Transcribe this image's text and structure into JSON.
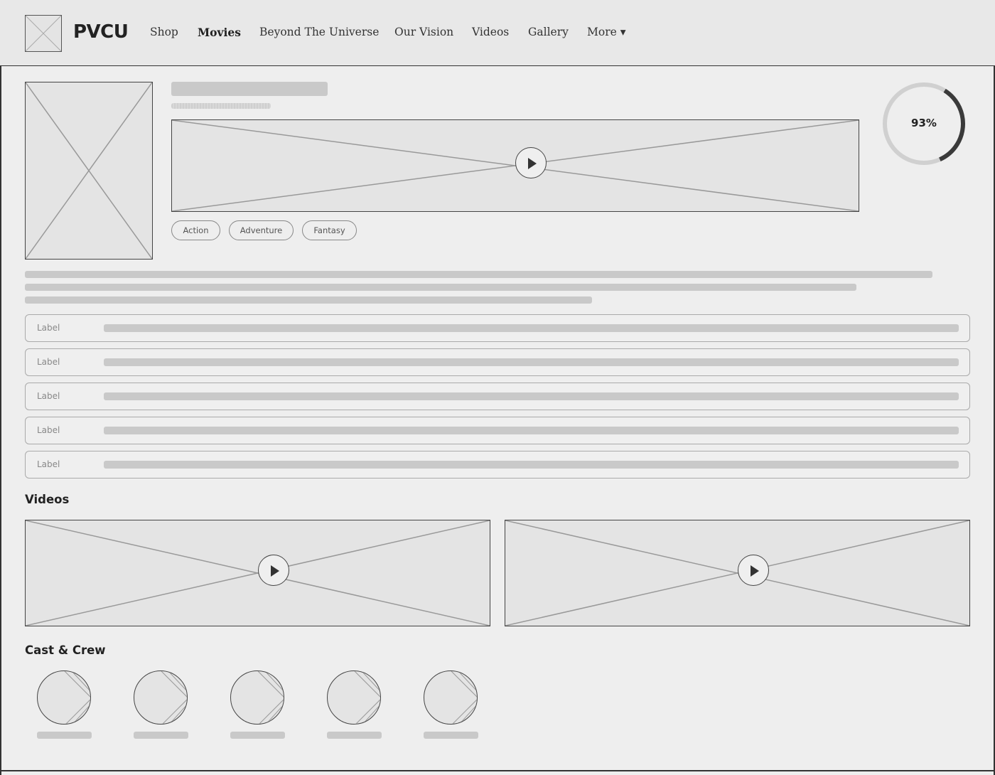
{
  "header": {
    "brand": "PVCU",
    "nav": [
      {
        "label": "Shop",
        "active": false
      },
      {
        "label": "Movies",
        "active": true
      },
      {
        "label": "Beyond The Universe",
        "active": false
      },
      {
        "label": "Our Vision",
        "active": false
      },
      {
        "label": "Videos",
        "active": false
      },
      {
        "label": "Gallery",
        "active": false
      },
      {
        "label": "More ▾",
        "active": false
      }
    ]
  },
  "movie": {
    "genres": [
      "Action",
      "Adventure",
      "Fantasy"
    ],
    "score_label": "93%",
    "score_fraction": 0.93
  },
  "details": {
    "rows": [
      {
        "label": "Label"
      },
      {
        "label": "Label"
      },
      {
        "label": "Label"
      },
      {
        "label": "Label"
      },
      {
        "label": "Label"
      }
    ]
  },
  "videos": {
    "title": "Videos"
  },
  "cast": {
    "title": "Cast & Crew"
  },
  "colors": {
    "background": "#eeeeee",
    "placeholder": "#e4e4e4",
    "skeleton": "#c9c9c9",
    "ring_track": "#d0d0d0",
    "ring_fill": "#3a3a3a"
  }
}
